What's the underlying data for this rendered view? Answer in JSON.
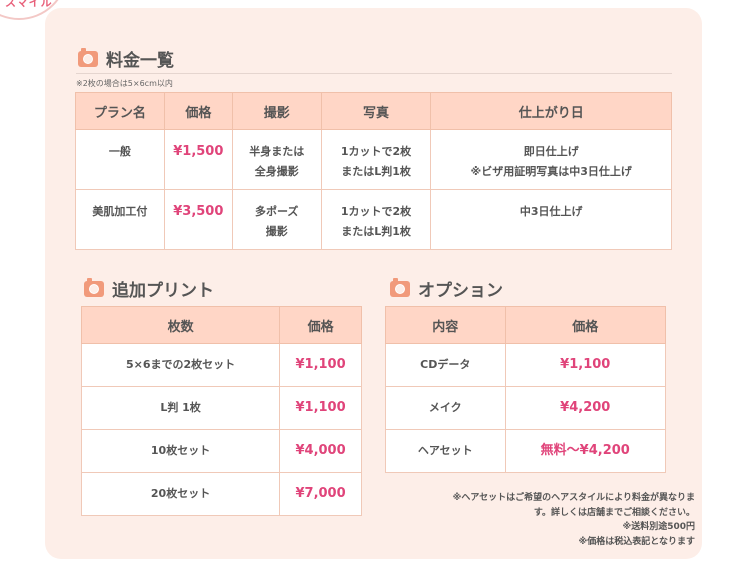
{
  "badge": {
    "text": "スマイル"
  },
  "pricing": {
    "title": "料金一覧",
    "note": "※2枚の場合は5×6cm以内",
    "headers": [
      "プラン名",
      "価格",
      "撮影",
      "写真",
      "仕上がり日"
    ],
    "rows": [
      {
        "plan": "一般",
        "price": "¥1,500",
        "shoot": [
          "半身または",
          "全身撮影"
        ],
        "photo": [
          "1カットで2枚",
          "またはL判1枚"
        ],
        "finish": [
          "即日仕上げ",
          "※ビザ用証明写真は中3日仕上げ"
        ]
      },
      {
        "plan": "美肌加工付",
        "price": "¥3,500",
        "shoot": [
          "多ポーズ",
          "撮影"
        ],
        "photo": [
          "1カットで2枚",
          "またはL判1枚"
        ],
        "finish": [
          "中3日仕上げ",
          ""
        ]
      }
    ]
  },
  "prints": {
    "title": "追加プリント",
    "headers": [
      "枚数",
      "価格"
    ],
    "rows": [
      {
        "label": "5×6までの2枚セット",
        "price": "¥1,100"
      },
      {
        "label": "L判 1枚",
        "price": "¥1,100"
      },
      {
        "label": "10枚セット",
        "price": "¥4,000"
      },
      {
        "label": "20枚セット",
        "price": "¥7,000"
      }
    ]
  },
  "options": {
    "title": "オプション",
    "headers": [
      "内容",
      "価格"
    ],
    "rows": [
      {
        "label": "CDデータ",
        "price": "¥1,100"
      },
      {
        "label": "メイク",
        "price": "¥4,200"
      },
      {
        "label": "ヘアセット",
        "price": "無料～¥4,200"
      }
    ]
  },
  "notes": [
    "※ヘアセットはご希望のヘアスタイルにより料金が異なりま",
    "す。詳しくは店舗までご相談ください。",
    "※送料別途500円",
    "※価格は税込表記となります"
  ],
  "colors": {
    "accent": "#e0447a",
    "header_bg": "#ffd6c6",
    "panel_bg": "#fdeee8",
    "icon": "#f19a7b"
  }
}
